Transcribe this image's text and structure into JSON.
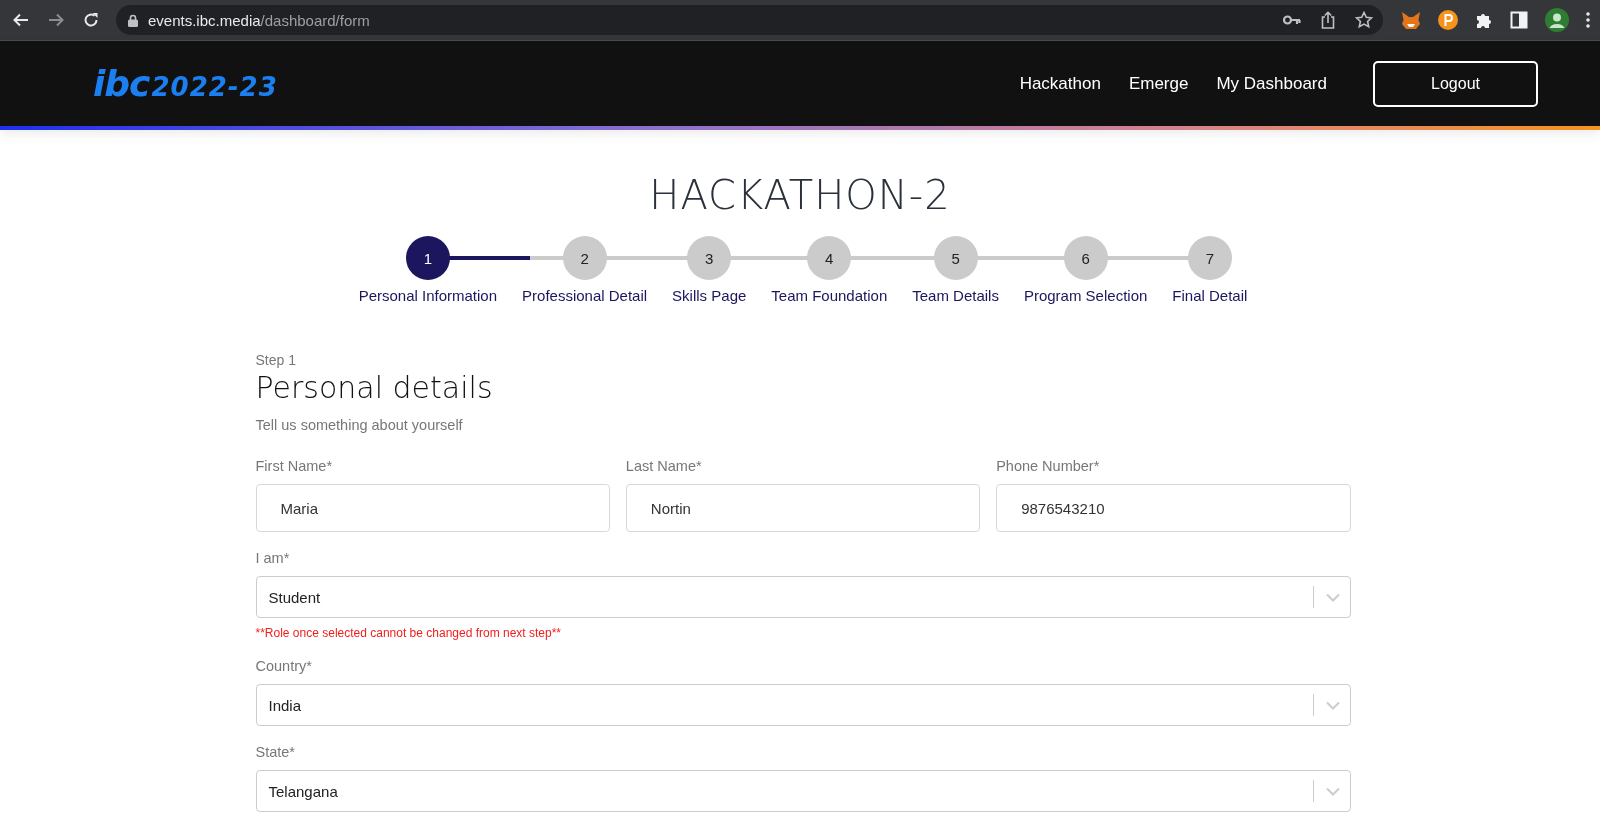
{
  "browser": {
    "url_host": "events.ibc.media",
    "url_path": "/dashboard/form"
  },
  "header": {
    "logo": {
      "mark": "ibc",
      "text": "2022-23"
    },
    "nav": [
      "Hackathon",
      "Emerge",
      "My Dashboard"
    ],
    "logout": "Logout"
  },
  "title": "HACKATHON-2",
  "steps": [
    {
      "number": "1",
      "label": "Personal Information",
      "selected": true
    },
    {
      "number": "2",
      "label": "Professional Detail",
      "selected": false
    },
    {
      "number": "3",
      "label": "Skills Page",
      "selected": false
    },
    {
      "number": "4",
      "label": "Team Foundation",
      "selected": false
    },
    {
      "number": "5",
      "label": "Team Details",
      "selected": false
    },
    {
      "number": "6",
      "label": "Program Selection",
      "selected": false
    },
    {
      "number": "7",
      "label": "Final Detail",
      "selected": false
    }
  ],
  "form": {
    "step": "Step 1",
    "heading": "Personal details",
    "subtitle": "Tell us something about yourself",
    "fields": [
      {
        "label": "First Name*",
        "value": "Maria"
      },
      {
        "label": "Last Name*",
        "value": "Nortin"
      },
      {
        "label": "Phone Number*",
        "value": "9876543210"
      }
    ],
    "selects": [
      {
        "label": "I am*",
        "value": "Student",
        "note": "**Role once selected cannot be changed from next step**"
      },
      {
        "label": "Country*",
        "value": "India"
      },
      {
        "label": "State*",
        "value": "Telangana"
      }
    ]
  }
}
